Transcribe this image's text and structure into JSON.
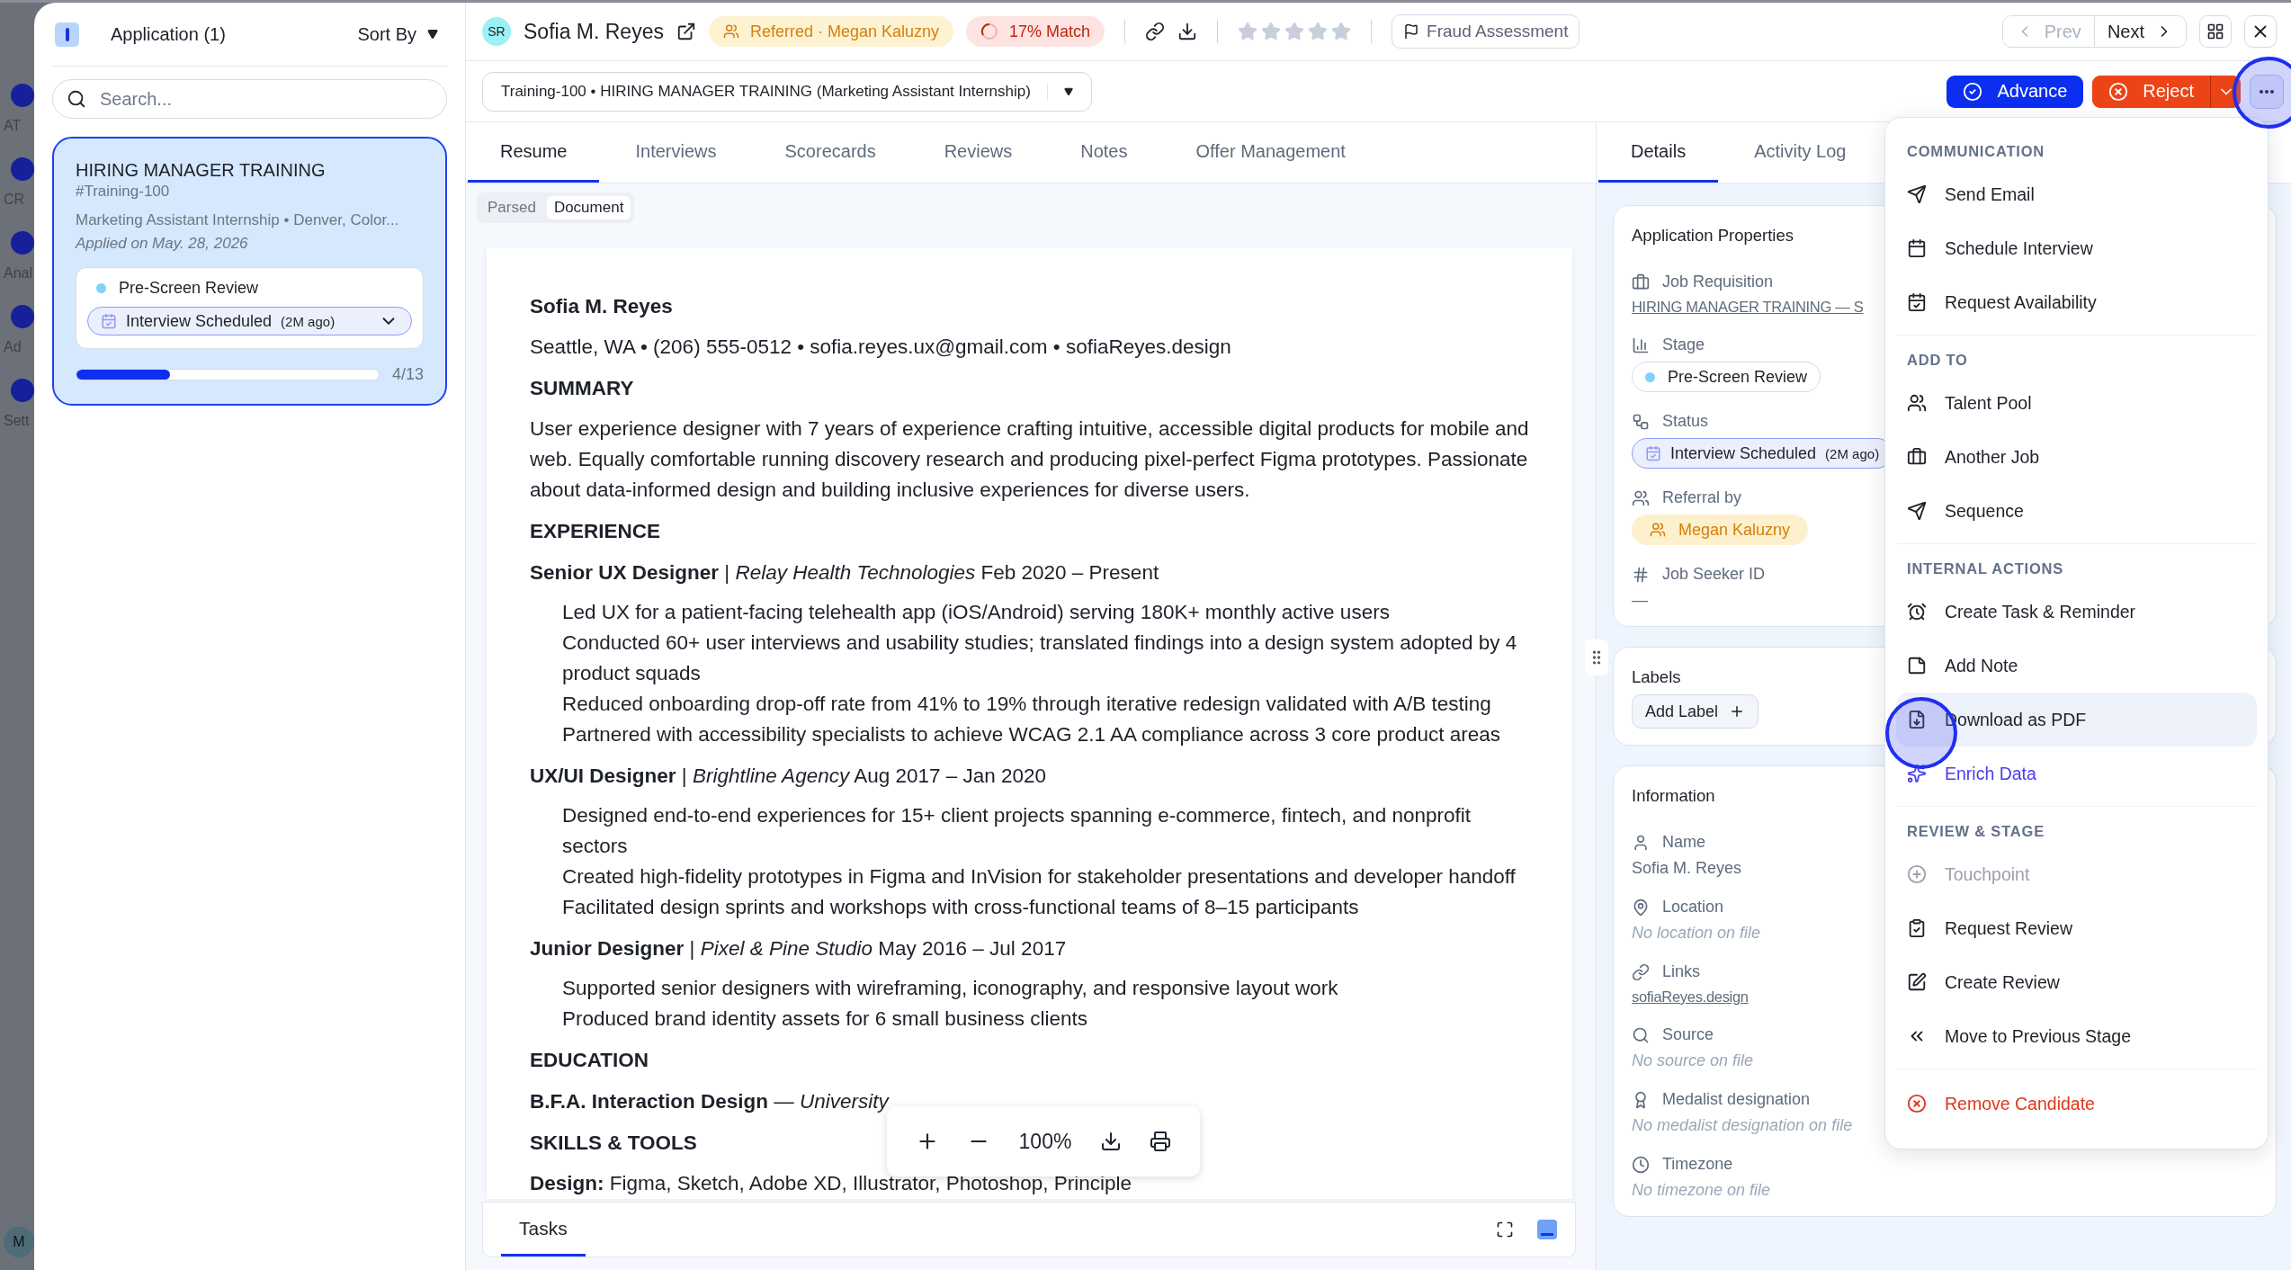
{
  "backdrop_nav": {
    "items": [
      {
        "label": "AT"
      },
      {
        "label": "CR"
      },
      {
        "label": "Anal"
      },
      {
        "label": "Ad"
      },
      {
        "label": "Sett"
      }
    ],
    "avatar": "M"
  },
  "applications_panel": {
    "title": "Application (1)",
    "sort_label": "Sort By",
    "search": {
      "placeholder": "Search..."
    },
    "cards": [
      {
        "title": "HIRING MANAGER TRAINING",
        "code": "#Training-100",
        "subtitle": "Marketing Assistant Internship • Denver, Color...",
        "applied": "Applied on May. 28, 2026",
        "selected": true,
        "stage": {
          "label": "Pre-Screen Review",
          "color": "#7dd3fc"
        },
        "status": {
          "label": "Interview Scheduled",
          "age": "(2M ago)"
        },
        "progress": {
          "level": 0.31,
          "reading": "4/13"
        }
      }
    ]
  },
  "header": {
    "avatar": "SR",
    "name": "Sofia M. Reyes",
    "referral": "Referred · Megan Kaluzny",
    "match": "17% Match",
    "stars": 0,
    "fraud": "Fraud Assessment",
    "prev": {
      "label": "Prev",
      "disabled": true
    },
    "next": {
      "label": "Next",
      "disabled": false
    }
  },
  "job_select": "Training-100 • HIRING MANAGER TRAINING (Marketing Assistant Internship)",
  "actions": {
    "advance": "Advance",
    "reject": "Reject"
  },
  "tabs": [
    {
      "label": "Resume",
      "selected": true
    },
    {
      "label": "Interviews",
      "selected": false
    },
    {
      "label": "Scorecards",
      "selected": false
    },
    {
      "label": "Reviews",
      "selected": false
    },
    {
      "label": "Notes",
      "selected": false
    },
    {
      "label": "Offer Management",
      "selected": false
    }
  ],
  "view_toggle": [
    {
      "label": "Parsed",
      "selected": false
    },
    {
      "label": "Document",
      "selected": true
    }
  ],
  "resume": {
    "name": "Sofia M. Reyes",
    "contact": "Seattle, WA • (206) 555-0512 • sofia.reyes.ux@gmail.com • sofiaReyes.design",
    "sections": [
      {
        "heading": "SUMMARY",
        "blocks": [
          {
            "kind": "paragraph",
            "text": "User experience designer with 7 years of experience crafting intuitive, accessible digital products for mobile and web. Equally comfortable running discovery research and producing pixel-perfect Figma prototypes. Passionate about data-informed design and building inclusive experiences for diverse users."
          }
        ]
      },
      {
        "heading": "EXPERIENCE",
        "blocks": [
          {
            "kind": "role",
            "text": "**Senior UX Designer** | *Relay Health Technologies* Feb 2020 – Present"
          },
          {
            "kind": "bullet",
            "text": "Led UX for a patient-facing telehealth app (iOS/Android) serving 180K+ monthly active users"
          },
          {
            "kind": "bullet",
            "text": "Conducted 60+ user interviews and usability studies; translated findings into a design system adopted by 4 product squads"
          },
          {
            "kind": "bullet",
            "text": "Reduced onboarding drop-off rate from 41% to 19% through iterative redesign validated with A/B testing"
          },
          {
            "kind": "bullet",
            "text": "Partnered with accessibility specialists to achieve WCAG 2.1 AA compliance across 3 core product areas"
          },
          {
            "kind": "role",
            "text": "**UX/UI Designer** | *Brightline Agency* Aug 2017 – Jan 2020"
          },
          {
            "kind": "bullet",
            "text": "Designed end-to-end experiences for 15+ client projects spanning e-commerce, fintech, and nonprofit sectors"
          },
          {
            "kind": "bullet",
            "text": "Created high-fidelity prototypes in Figma and InVision for stakeholder presentations and developer handoff"
          },
          {
            "kind": "bullet",
            "text": "Facilitated design sprints and workshops with cross-functional teams of 8–15 participants"
          },
          {
            "kind": "role",
            "text": "**Junior Designer** | *Pixel & Pine Studio* May 2016 – Jul 2017"
          },
          {
            "kind": "bullet",
            "text": "Supported senior designers with wireframing, iconography, and responsive layout work"
          },
          {
            "kind": "bullet",
            "text": "Produced brand identity assets for 6 small business clients"
          }
        ]
      },
      {
        "heading": "EDUCATION",
        "blocks": [
          {
            "kind": "role",
            "text": "**B.F.A. Interaction Design** — *University*"
          }
        ]
      },
      {
        "heading": "SKILLS & TOOLS",
        "blocks": [
          {
            "kind": "paragraph",
            "text": "**Design:** Figma, Sketch, Adobe XD, Illustrator, Photoshop, Principle"
          }
        ]
      }
    ]
  },
  "viewer_toolbar": {
    "zoom": "100%"
  },
  "tasks_bar": {
    "label": "Tasks"
  },
  "details": {
    "tabs": [
      {
        "label": "Details",
        "selected": true
      },
      {
        "label": "Activity Log",
        "selected": false
      }
    ],
    "properties": {
      "title": "Application Properties",
      "fields": [
        {
          "kind": "link",
          "label": "Job Requisition",
          "value": "HIRING MANAGER TRAINING — S"
        },
        {
          "kind": "stage",
          "label": "Stage",
          "value": "Pre-Screen Review",
          "color": "#7dd3fc"
        },
        {
          "kind": "status",
          "label": "Status",
          "value": "Interview Scheduled",
          "age": "(2M ago)"
        },
        {
          "kind": "referral",
          "label": "Referral by",
          "value": "Megan Kaluzny"
        },
        {
          "kind": "text",
          "label": "Job Seeker ID",
          "value": "—"
        }
      ]
    },
    "labels": {
      "title": "Labels",
      "button": "Add Label"
    },
    "information": {
      "title": "Information",
      "fields": [
        {
          "kind": "text",
          "label": "Name",
          "value": "Sofia M. Reyes"
        },
        {
          "kind": "empty",
          "label": "Location",
          "value": "No location on file"
        },
        {
          "kind": "link",
          "label": "Links",
          "value": "sofiaReyes.design"
        },
        {
          "kind": "empty",
          "label": "Source",
          "value": "No source on file"
        },
        {
          "kind": "empty",
          "label": "Medalist designation",
          "value": "No medalist designation on file"
        },
        {
          "kind": "empty",
          "label": "Timezone",
          "value": "No timezone on file"
        }
      ]
    }
  },
  "menu": {
    "sections": [
      {
        "heading": "COMMUNICATION",
        "items": [
          {
            "label": "Send Email",
            "kind": "normal",
            "disabled": false,
            "highlighted": false
          },
          {
            "label": "Schedule Interview",
            "kind": "normal",
            "disabled": false,
            "highlighted": false
          },
          {
            "label": "Request Availability",
            "kind": "normal",
            "disabled": false,
            "highlighted": false
          }
        ]
      },
      {
        "heading": "ADD TO",
        "items": [
          {
            "label": "Talent Pool",
            "kind": "normal",
            "disabled": false,
            "highlighted": false
          },
          {
            "label": "Another Job",
            "kind": "normal",
            "disabled": false,
            "highlighted": false
          },
          {
            "label": "Sequence",
            "kind": "normal",
            "disabled": false,
            "highlighted": false
          }
        ]
      },
      {
        "heading": "INTERNAL ACTIONS",
        "items": [
          {
            "label": "Create Task & Reminder",
            "kind": "normal",
            "disabled": false,
            "highlighted": false
          },
          {
            "label": "Add Note",
            "kind": "normal",
            "disabled": false,
            "highlighted": false
          },
          {
            "label": "Download as PDF",
            "kind": "normal",
            "disabled": false,
            "highlighted": true
          },
          {
            "label": "Enrich Data",
            "kind": "accent",
            "disabled": false,
            "highlighted": false
          }
        ]
      },
      {
        "heading": "REVIEW & STAGE",
        "items": [
          {
            "label": "Touchpoint",
            "kind": "normal",
            "disabled": true,
            "highlighted": false
          },
          {
            "label": "Request Review",
            "kind": "normal",
            "disabled": false,
            "highlighted": false
          },
          {
            "label": "Create Review",
            "kind": "normal",
            "disabled": false,
            "highlighted": false
          },
          {
            "label": "Move to Previous Stage",
            "kind": "normal",
            "disabled": false,
            "highlighted": false
          }
        ]
      },
      {
        "items": [
          {
            "label": "Remove Candidate",
            "kind": "danger",
            "disabled": false,
            "highlighted": false
          }
        ]
      }
    ]
  }
}
